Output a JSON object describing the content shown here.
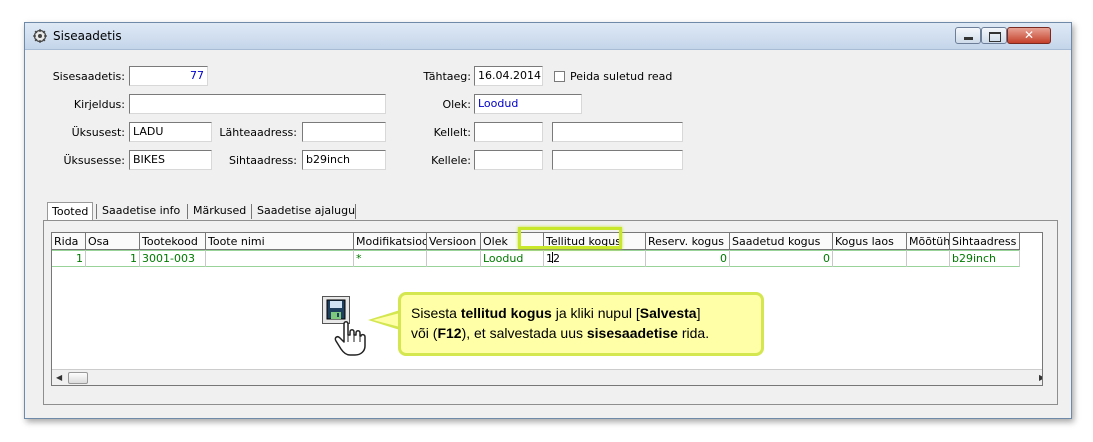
{
  "window": {
    "title": "Siseaadetis",
    "close_glyph": "✕"
  },
  "form": {
    "sisesaadetis_label": "Sisesaadetis:",
    "sisesaadetis_value": "77",
    "kirjeldus_label": "Kirjeldus:",
    "kirjeldus_value": "",
    "uksusest_label": "Üksusest:",
    "uksusest_value": "LADU",
    "lahteaadress_label": "Lähteaadress:",
    "lahteaadress_value": "",
    "uksusesse_label": "Üksusesse:",
    "uksusesse_value": "BIKES",
    "sihtaadress_label": "Sihtaadress:",
    "sihtaadress_value": "b29inch",
    "tahtaeg_label": "Tähtaeg:",
    "tahtaeg_value": "16.04.2014",
    "peida_label": "Peida suletud read",
    "olek_label": "Olek:",
    "olek_value": "Loodud",
    "kellelt_label": "Kellelt:",
    "kellele_label": "Kellele:"
  },
  "tabs": [
    "Tooted",
    "Saadetise info",
    "Märkused",
    "Saadetise ajalugu"
  ],
  "grid": {
    "columns": [
      "Rida",
      "Osa",
      "Tootekood",
      "Toote nimi",
      "Modifikatsioon",
      "Versioon",
      "Olek",
      "Tellitud kogus",
      "Reserv. kogus",
      "Saadetud kogus",
      "Kogus laos",
      "Mõõtühik",
      "Sihtaadress"
    ],
    "rows": [
      [
        "1",
        "1",
        "3001-003",
        "",
        "*",
        "",
        "Loodud",
        "12",
        "0",
        "0",
        "",
        "",
        "b29inch"
      ]
    ]
  },
  "callout": {
    "t1": "Sisesta ",
    "b1": "tellitud kogus",
    "t2": " ja kliki nupul  [",
    "b2": "Salvesta",
    "t3": "]",
    "t4": "või (",
    "b3": "F12",
    "t5": "), et salvestada uus ",
    "b4": "sisesaadetise",
    "t6": " rida."
  },
  "icons": {
    "window_icon": "window-icon",
    "save": "save-icon",
    "hand": "hand-pointer-icon"
  },
  "colors": {
    "highlight": "#c8e62a",
    "callout_bg": "#ffffa8",
    "row_text": "#007a00",
    "link_blue": "#0000cc"
  }
}
